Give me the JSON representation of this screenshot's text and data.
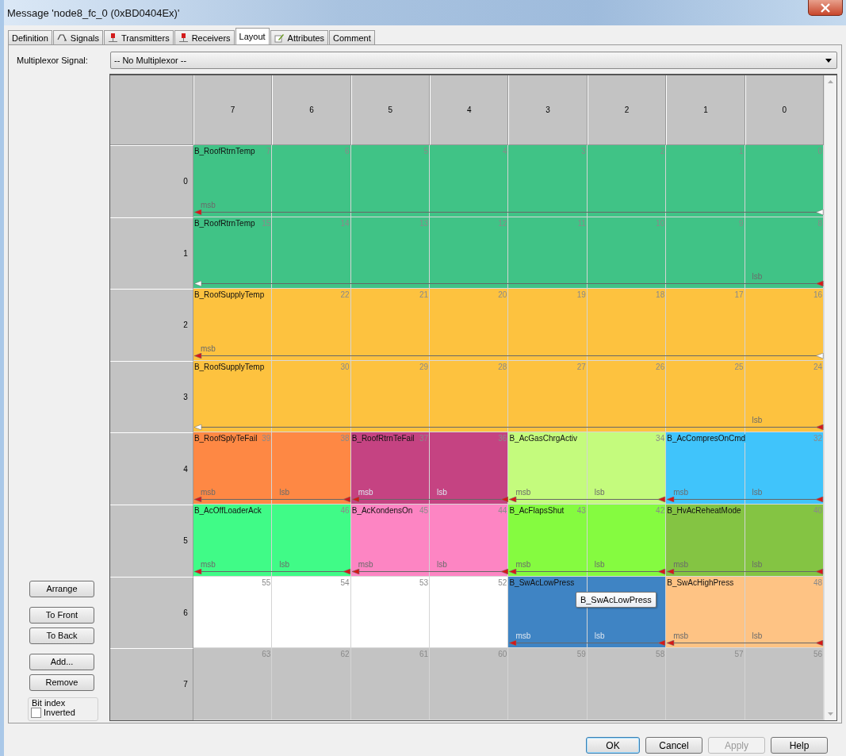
{
  "window": {
    "title": "Message 'node8_fc_0 (0xBD0404Ex)'"
  },
  "tabs": [
    {
      "label": "Definition",
      "selected": false,
      "kind": "plain"
    },
    {
      "label": "Signals",
      "selected": false,
      "kind": "wave"
    },
    {
      "label": "Transmitters",
      "selected": false,
      "kind": "pin"
    },
    {
      "label": "Receivers",
      "selected": false,
      "kind": "pin"
    },
    {
      "label": "Layout",
      "selected": true,
      "kind": "plain"
    },
    {
      "label": "Attributes",
      "selected": false,
      "kind": "pencil"
    },
    {
      "label": "Comment",
      "selected": false,
      "kind": "plain"
    }
  ],
  "multiplexor": {
    "label": "Multiplexor Signal:",
    "value": "-- No Multiplexor --"
  },
  "side_button_groups": [
    [
      "Arrange"
    ],
    [
      "To Front",
      "To Back"
    ],
    [
      "Add...",
      "Remove"
    ]
  ],
  "bit_index": {
    "title": "Bit index",
    "option": {
      "label": "Inverted",
      "checked": false
    }
  },
  "layout": {
    "columns": [
      "7",
      "6",
      "5",
      "4",
      "3",
      "2",
      "1",
      "0"
    ],
    "rows": [
      {
        "label": "0",
        "segments": [
          {
            "name": "B_RoofRtrnTemp",
            "color": "#40c386",
            "continued_left": false,
            "continued_right": true,
            "cells": [
              {
                "bit": "7",
                "label": "msb"
              },
              {
                "bit": "6"
              },
              {
                "bit": "5"
              },
              {
                "bit": "4"
              },
              {
                "bit": "3"
              },
              {
                "bit": "2"
              },
              {
                "bit": "1"
              },
              {
                "bit": "0"
              }
            ]
          }
        ]
      },
      {
        "label": "1",
        "segments": [
          {
            "name": "B_RoofRtrnTemp",
            "color": "#40c386",
            "continued_left": true,
            "continued_right": false,
            "cells": [
              {
                "bit": "15"
              },
              {
                "bit": "14"
              },
              {
                "bit": "13"
              },
              {
                "bit": "12"
              },
              {
                "bit": "11"
              },
              {
                "bit": "10"
              },
              {
                "bit": "9"
              },
              {
                "bit": "8",
                "label": "lsb"
              }
            ]
          }
        ]
      },
      {
        "label": "2",
        "segments": [
          {
            "name": "B_RoofSupplyTemp",
            "color": "#fdc23f",
            "continued_left": false,
            "continued_right": true,
            "cells": [
              {
                "label": "msb"
              },
              {
                "bit": "22"
              },
              {
                "bit": "21"
              },
              {
                "bit": "20"
              },
              {
                "bit": "19"
              },
              {
                "bit": "18"
              },
              {
                "bit": "17"
              },
              {
                "bit": "16"
              }
            ]
          }
        ]
      },
      {
        "label": "3",
        "segments": [
          {
            "name": "B_RoofSupplyTemp",
            "color": "#fdc23f",
            "continued_left": true,
            "continued_right": false,
            "cells": [
              {},
              {
                "bit": "30"
              },
              {
                "bit": "29"
              },
              {
                "bit": "28"
              },
              {
                "bit": "27"
              },
              {
                "bit": "26"
              },
              {
                "bit": "25"
              },
              {
                "bit": "24",
                "label": "lsb"
              }
            ]
          }
        ]
      },
      {
        "label": "4",
        "segments": [
          {
            "name": "B_RoofSplyTeFail",
            "color": "#fe8844",
            "continued_left": false,
            "continued_right": false,
            "cells": [
              {
                "bit": "39",
                "label": "msb"
              },
              {
                "bit": "38",
                "label": "lsb"
              }
            ]
          },
          {
            "name": "B_RoofRtrnTeFail",
            "color": "#c54382",
            "continued_left": false,
            "continued_right": false,
            "cells": [
              {
                "bit": "37",
                "label": "msb"
              },
              {
                "bit": "36",
                "label": "lsb"
              }
            ]
          },
          {
            "name": "B_AcGasChrgActiv",
            "color": "#c4fb7d",
            "continued_left": false,
            "continued_right": false,
            "cells": [
              {
                "label": "msb"
              },
              {
                "bit": "34",
                "label": "lsb"
              }
            ]
          },
          {
            "name": "B_AcCompresOnCmd",
            "color": "#40c4fb",
            "continued_left": false,
            "continued_right": false,
            "cells": [
              {
                "label": "msb"
              },
              {
                "bit": "32",
                "label": "lsb"
              }
            ]
          }
        ]
      },
      {
        "label": "5",
        "segments": [
          {
            "name": "B_AcOffLoaderAck",
            "color": "#40fb87",
            "continued_left": false,
            "continued_right": false,
            "cells": [
              {
                "label": "msb"
              },
              {
                "bit": "46",
                "label": "lsb"
              }
            ]
          },
          {
            "name": "B_AcKondensOn",
            "color": "#fd85c3",
            "continued_left": false,
            "continued_right": false,
            "cells": [
              {
                "bit": "45",
                "label": "msb"
              },
              {
                "bit": "44",
                "label": "lsb"
              }
            ]
          },
          {
            "name": "B_AcFlapsShut",
            "color": "#85fb40",
            "continued_left": false,
            "continued_right": false,
            "cells": [
              {
                "bit": "43",
                "label": "msb"
              },
              {
                "bit": "42",
                "label": "lsb"
              }
            ]
          },
          {
            "name": "B_HvAcReheatMode",
            "color": "#84c443",
            "continued_left": false,
            "continued_right": false,
            "cells": [
              {
                "label": "msb"
              },
              {
                "bit": "40",
                "label": "lsb"
              }
            ]
          }
        ]
      },
      {
        "label": "6",
        "segments": [
          {
            "color": "#ffffff",
            "cells": [
              {
                "bit": "55"
              },
              {
                "bit": "54"
              },
              {
                "bit": "53"
              },
              {
                "bit": "52"
              }
            ]
          },
          {
            "name": "B_SwAcLowPress",
            "color": "#3f84c4",
            "continued_left": false,
            "continued_right": false,
            "cells": [
              {
                "label": "msb"
              },
              {
                "label": "lsb"
              }
            ]
          },
          {
            "name": "B_SwAcHighPress",
            "color": "#fec384",
            "continued_left": false,
            "continued_right": false,
            "cells": [
              {
                "label": "msb"
              },
              {
                "bit": "48",
                "label": "lsb"
              }
            ]
          }
        ]
      },
      {
        "label": "7",
        "segments": [
          {
            "color": "#c3c3c3",
            "cells": [
              {
                "bit": "63"
              },
              {
                "bit": "62"
              },
              {
                "bit": "61"
              },
              {
                "bit": "60"
              },
              {
                "bit": "59"
              },
              {
                "bit": "58"
              },
              {
                "bit": "57"
              },
              {
                "bit": "56"
              }
            ]
          }
        ]
      }
    ],
    "tooltip": "B_SwAcLowPress"
  },
  "buttons": [
    {
      "label": "OK",
      "disabled": false
    },
    {
      "label": "Cancel",
      "disabled": false
    },
    {
      "label": "Apply",
      "disabled": true
    },
    {
      "label": "Help",
      "disabled": false
    }
  ]
}
